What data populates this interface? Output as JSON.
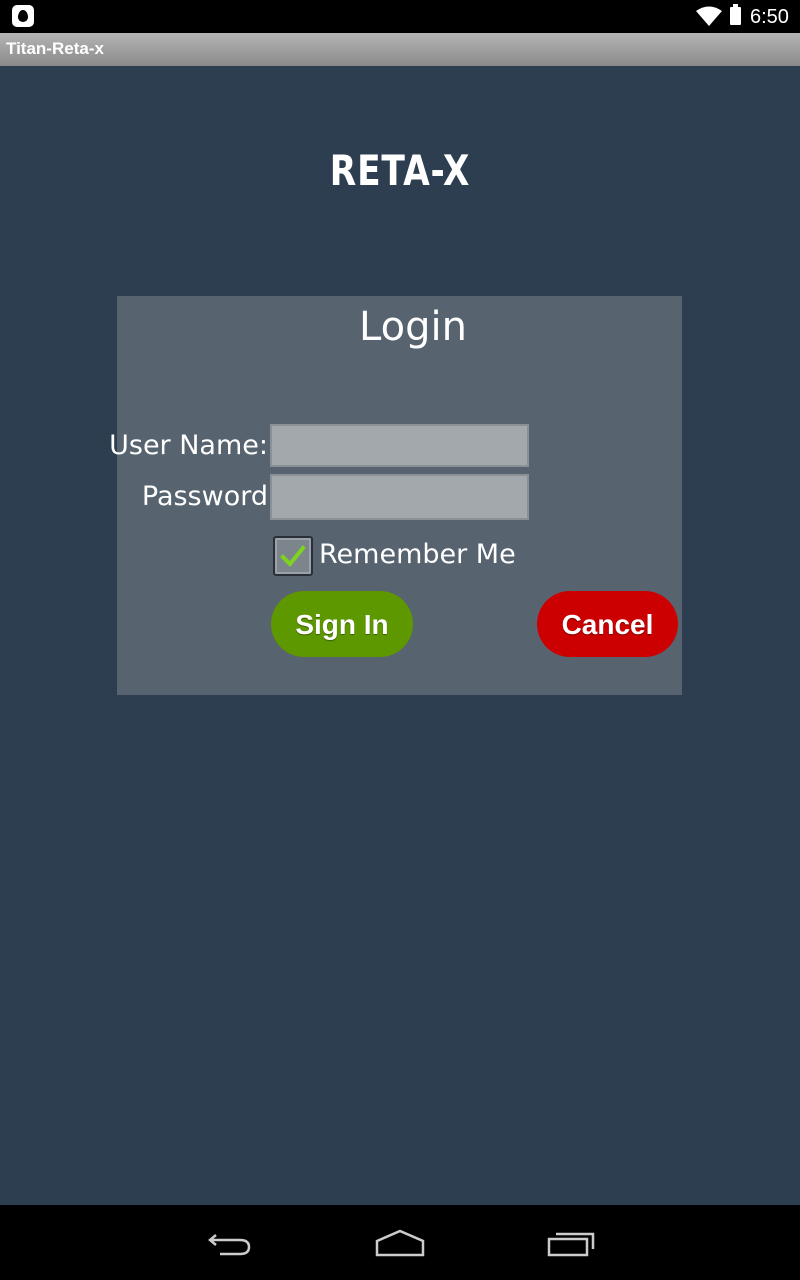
{
  "status_bar": {
    "time": "6:50",
    "icons": [
      "app-notification-icon",
      "wifi-icon",
      "battery-icon"
    ]
  },
  "title_bar": {
    "title": "Titan-Reta-x"
  },
  "brand": {
    "logo_text": "RETA-X"
  },
  "login": {
    "title": "Login",
    "username_label": "User Name:",
    "username_value": "",
    "password_label": "Password",
    "password_value": "",
    "remember_label": "Remember Me",
    "remember_checked": true,
    "signin_label": "Sign In",
    "cancel_label": "Cancel"
  },
  "nav_bar": {
    "icons": [
      "back-icon",
      "home-icon",
      "recent-apps-icon"
    ]
  },
  "colors": {
    "background": "#2e3e51",
    "panel": "#57636f",
    "signin": "#5e9800",
    "cancel": "#cc0000",
    "check": "#7ed321"
  }
}
